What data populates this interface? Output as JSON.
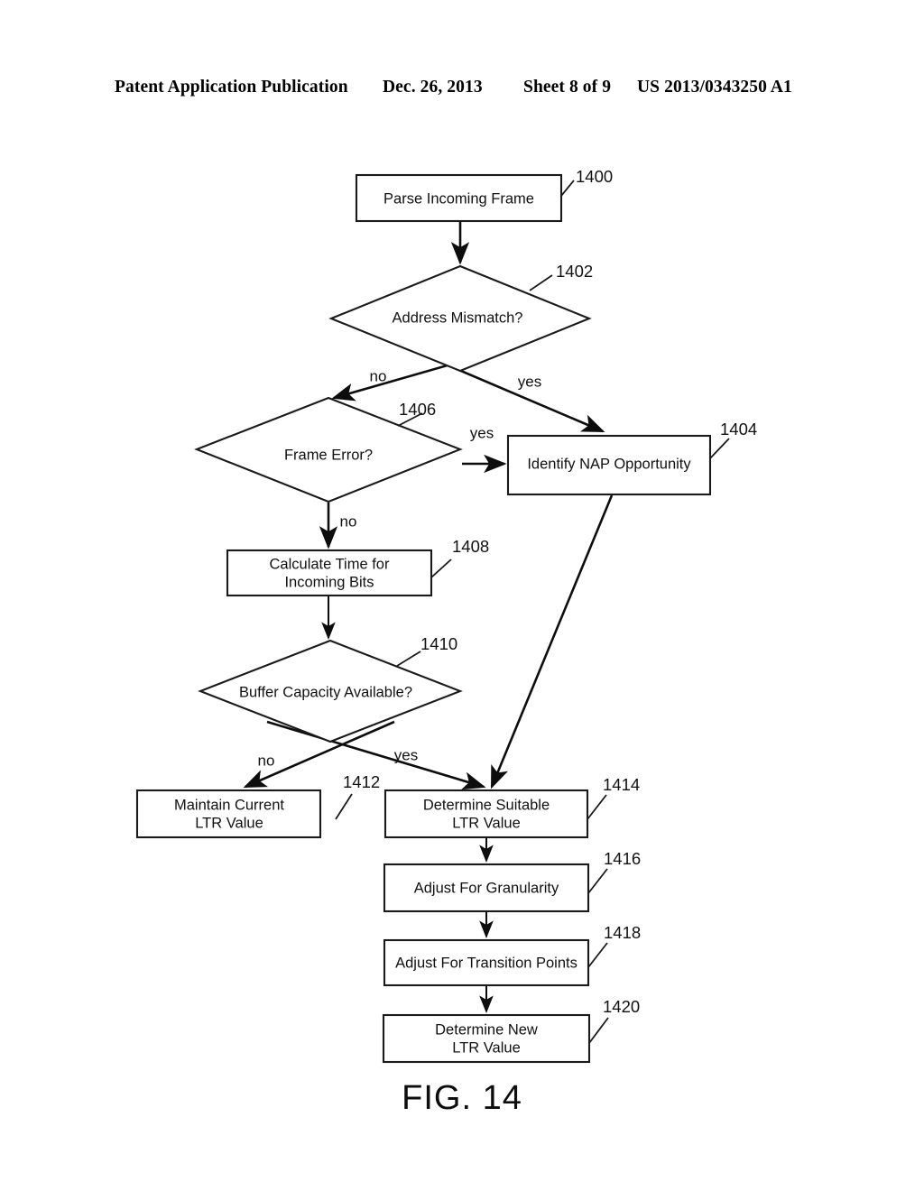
{
  "header": {
    "left": "Patent Application Publication",
    "date": "Dec. 26, 2013",
    "sheet": "Sheet 8 of 9",
    "publication_number": "US 2013/0343250 A1"
  },
  "figure": {
    "caption": "FIG. 14"
  },
  "nodes": {
    "n1400": {
      "ref": "1400",
      "line1": "Parse Incoming Frame",
      "line2": "",
      "shape": "process"
    },
    "n1402": {
      "ref": "1402",
      "line1": "Address Mismatch?",
      "line2": "",
      "shape": "decision"
    },
    "n1404": {
      "ref": "1404",
      "line1": "Identify NAP Opportunity",
      "line2": "",
      "shape": "process"
    },
    "n1406": {
      "ref": "1406",
      "line1": "Frame Error?",
      "line2": "",
      "shape": "decision"
    },
    "n1408": {
      "ref": "1408",
      "line1": "Calculate Time for",
      "line2": "Incoming Bits",
      "shape": "process"
    },
    "n1410": {
      "ref": "1410",
      "line1": "Buffer Capacity Available?",
      "line2": "",
      "shape": "decision"
    },
    "n1412": {
      "ref": "1412",
      "line1": "Maintain Current",
      "line2": "LTR Value",
      "shape": "process"
    },
    "n1414": {
      "ref": "1414",
      "line1": "Determine Suitable",
      "line2": "LTR Value",
      "shape": "process"
    },
    "n1416": {
      "ref": "1416",
      "line1": "Adjust For Granularity",
      "line2": "",
      "shape": "process"
    },
    "n1418": {
      "ref": "1418",
      "line1": "Adjust For Transition Points",
      "line2": "",
      "shape": "process"
    },
    "n1420": {
      "ref": "1420",
      "line1": "Determine New",
      "line2": "LTR Value",
      "shape": "process"
    }
  },
  "branches": {
    "mismatch_no": "no",
    "mismatch_yes": "yes",
    "frame_error_yes": "yes",
    "frame_error_no": "no",
    "buffer_no": "no",
    "buffer_yes": "yes"
  },
  "colors": {
    "ink": "#0d0d0d",
    "paper": "#ffffff"
  }
}
